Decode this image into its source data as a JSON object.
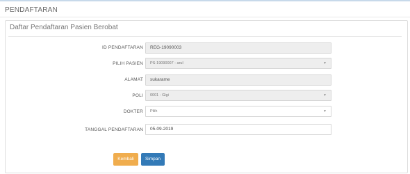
{
  "page": {
    "title": "PENDAFTARAN",
    "panel_heading": "Daftar Pendaftaran Pasien Berobat"
  },
  "form": {
    "id_label": "ID PENDAFTARAN",
    "id_value": "REG-19090003",
    "pasien_label": "PILIH PASIEN",
    "pasien_value": "PS-19090007 - arul",
    "alamat_label": "ALAMAT",
    "alamat_value": "sukarame",
    "poli_label": "POLI",
    "poli_value": "0001 - Gigi",
    "dokter_label": "DOKTER",
    "dokter_value": "Pilih",
    "tanggal_label": "TANGGAL PENDAFTARAN",
    "tanggal_value": "05-09-2019"
  },
  "buttons": {
    "kembali": "Kembali",
    "simpan": "Simpan"
  },
  "colors": {
    "kembali_bg": "#f0ad4e",
    "simpan_bg": "#337ab7"
  }
}
